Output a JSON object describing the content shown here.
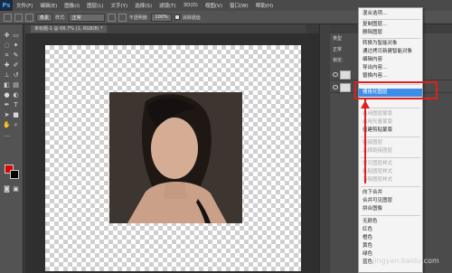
{
  "menubar": {
    "logo": "Ps",
    "items": [
      "文件(F)",
      "编辑(E)",
      "图像(I)",
      "图层(L)",
      "文字(Y)",
      "选择(S)",
      "滤镜(T)",
      "3D(D)",
      "视图(V)",
      "窗口(W)",
      "帮助(H)"
    ]
  },
  "options": {
    "size_value": "像素",
    "style_label": "样式:",
    "style_value": "正常",
    "opacity_label": "不透明度:",
    "opacity_value": "100%",
    "smooth_label": "消除锯齿"
  },
  "document": {
    "tab_label": "未标题-1 @ 66.7% (1, RGB/8) *"
  },
  "toolbar": {
    "fg_color": "#e00000",
    "bg_color": "#000000"
  },
  "layers": {
    "kind_label": "类型",
    "mode_label": "正常",
    "lock_label": "锁定:"
  },
  "context_menu": {
    "items": [
      {
        "label": "混合选项...",
        "state": "normal"
      },
      {
        "label": "复制图层...",
        "state": "normal"
      },
      {
        "label": "删除图层",
        "state": "normal"
      },
      {
        "label": "转换为智能对象",
        "state": "normal"
      },
      {
        "label": "通过拷贝新建智能对象",
        "state": "normal"
      },
      {
        "label": "编辑内容",
        "state": "normal"
      },
      {
        "label": "导出内容...",
        "state": "normal"
      },
      {
        "label": "替换内容...",
        "state": "normal"
      },
      {
        "label": "栅格化图层",
        "state": "active"
      },
      {
        "label": "启用图层蒙版",
        "state": "disabled"
      },
      {
        "label": "启用矢量蒙版",
        "state": "disabled"
      },
      {
        "label": "创建剪贴蒙版",
        "state": "normal"
      },
      {
        "label": "链接图层",
        "state": "disabled"
      },
      {
        "label": "选择链接图层",
        "state": "disabled"
      },
      {
        "label": "拷贝图层样式",
        "state": "disabled"
      },
      {
        "label": "粘贴图层样式",
        "state": "disabled"
      },
      {
        "label": "清除图层样式",
        "state": "disabled"
      },
      {
        "label": "向下合并",
        "state": "normal"
      },
      {
        "label": "合并可见图层",
        "state": "normal"
      },
      {
        "label": "拼合图像",
        "state": "normal"
      },
      {
        "label": "无颜色",
        "state": "normal"
      },
      {
        "label": "红色",
        "state": "normal"
      },
      {
        "label": "橙色",
        "state": "normal"
      },
      {
        "label": "黄色",
        "state": "normal"
      },
      {
        "label": "绿色",
        "state": "normal"
      },
      {
        "label": "蓝色",
        "state": "normal"
      }
    ]
  },
  "annotation": {
    "color": "#e02020"
  },
  "watermark": {
    "text": "jingyan.baidu.com"
  }
}
